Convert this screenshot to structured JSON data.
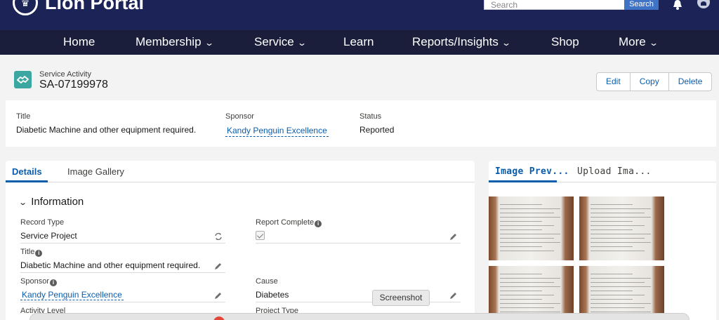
{
  "header": {
    "logo_text": "Lion Portal",
    "search_placeholder": "Search",
    "search_button": "Search",
    "icons": [
      "lion-logo-icon",
      "bell-icon",
      "avatar"
    ]
  },
  "nav": {
    "items": [
      {
        "label": "Home",
        "dropdown": false
      },
      {
        "label": "Membership",
        "dropdown": true
      },
      {
        "label": "Service",
        "dropdown": true
      },
      {
        "label": "Learn",
        "dropdown": false
      },
      {
        "label": "Reports/Insights",
        "dropdown": true
      },
      {
        "label": "Shop",
        "dropdown": false
      },
      {
        "label": "More",
        "dropdown": true
      }
    ]
  },
  "record": {
    "type_label": "Service Activity",
    "id": "SA-07199978",
    "actions": [
      "Edit",
      "Copy",
      "Delete"
    ]
  },
  "highlights": {
    "title_label": "Title",
    "title_value": "Diabetic Machine and other equipment required.",
    "sponsor_label": "Sponsor",
    "sponsor_value": "Kandy Penguin Excellence",
    "status_label": "Status",
    "status_value": "Reported"
  },
  "details": {
    "tabs": [
      "Details",
      "Image Gallery"
    ],
    "active_tab": "Details",
    "section_title": "Information",
    "fields": {
      "record_type": {
        "label": "Record Type",
        "value": "Service Project"
      },
      "report_complete": {
        "label": "Report Complete",
        "checked": true
      },
      "title": {
        "label": "Title",
        "value": "Diabetic Machine and other equipment required."
      },
      "sponsor": {
        "label": "Sponsor",
        "value": "Kandy Penguin Excellence"
      },
      "cause": {
        "label": "Cause",
        "value": "Diabetes"
      },
      "activity_level": {
        "label": "Activity Level"
      },
      "project_type": {
        "label": "Project Type"
      }
    }
  },
  "gallery": {
    "tabs": [
      "Image Prev...",
      "Upload Ima..."
    ],
    "active_tab": "Image Prev..."
  },
  "overlay": {
    "tooltip": "Screenshot"
  },
  "colors": {
    "header_bg": "#1c2457",
    "nav_bg": "#1a1e3a",
    "link": "#0b5cab",
    "record_icon": "#3ba7a0",
    "search_button": "#3f73c5"
  }
}
